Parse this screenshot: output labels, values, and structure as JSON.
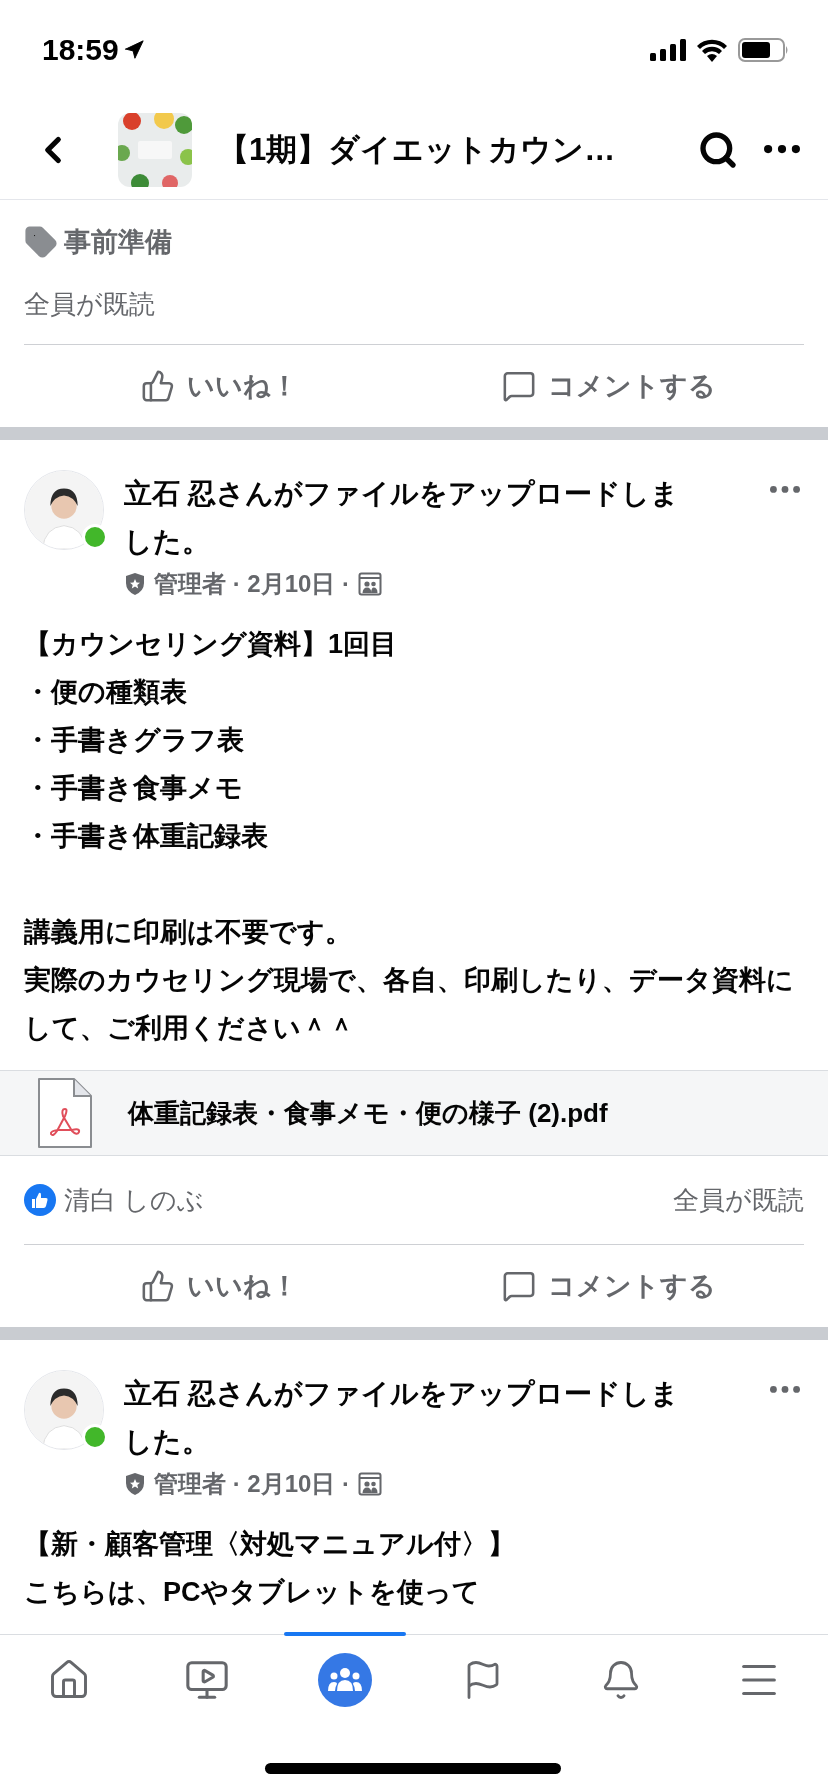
{
  "status_bar": {
    "time": "18:59"
  },
  "header": {
    "title": "【1期】ダイエットカウン…"
  },
  "top_post": {
    "tag": "事前準備",
    "seen": "全員が既読",
    "actions": [
      "いいね！",
      "コメントする"
    ]
  },
  "posts": [
    {
      "author_line": "立石 忍さんがファイルをアップロードしました。",
      "online": true,
      "meta": "管理者 · 2月10日 ·",
      "paragraphs": [
        [
          "【カウンセリング資料】1回目",
          "・便の種類表",
          "・手書きグラフ表",
          "・手書き食事メモ",
          "・手書き体重記録表"
        ],
        [
          "講義用に印刷は不要です。",
          "実際のカウセリング現場で、各自、印刷したり、データ資料にして、ご利用ください＾＾"
        ]
      ],
      "attachment": {
        "name": "体重記録表・食事メモ・便の様子 (2).pdf"
      },
      "reaction": {
        "name": "清白 しのぶ"
      },
      "seen": "全員が既読",
      "actions": [
        "いいね！",
        "コメントする"
      ]
    },
    {
      "author_line": "立石 忍さんがファイルをアップロードしました。",
      "online": true,
      "meta": "管理者 · 2月10日 ·",
      "paragraphs": [
        [
          "【新・顧客管理〈対処マニュアル付〉】",
          "こちらは、PCやタブレットを使って"
        ]
      ]
    }
  ],
  "tab_bar": [
    {
      "kind": "home",
      "selected": false
    },
    {
      "kind": "video",
      "selected": false
    },
    {
      "kind": "groups",
      "selected": true
    },
    {
      "kind": "pages",
      "selected": false
    },
    {
      "kind": "notifications",
      "selected": false
    },
    {
      "kind": "menu",
      "selected": false
    }
  ]
}
